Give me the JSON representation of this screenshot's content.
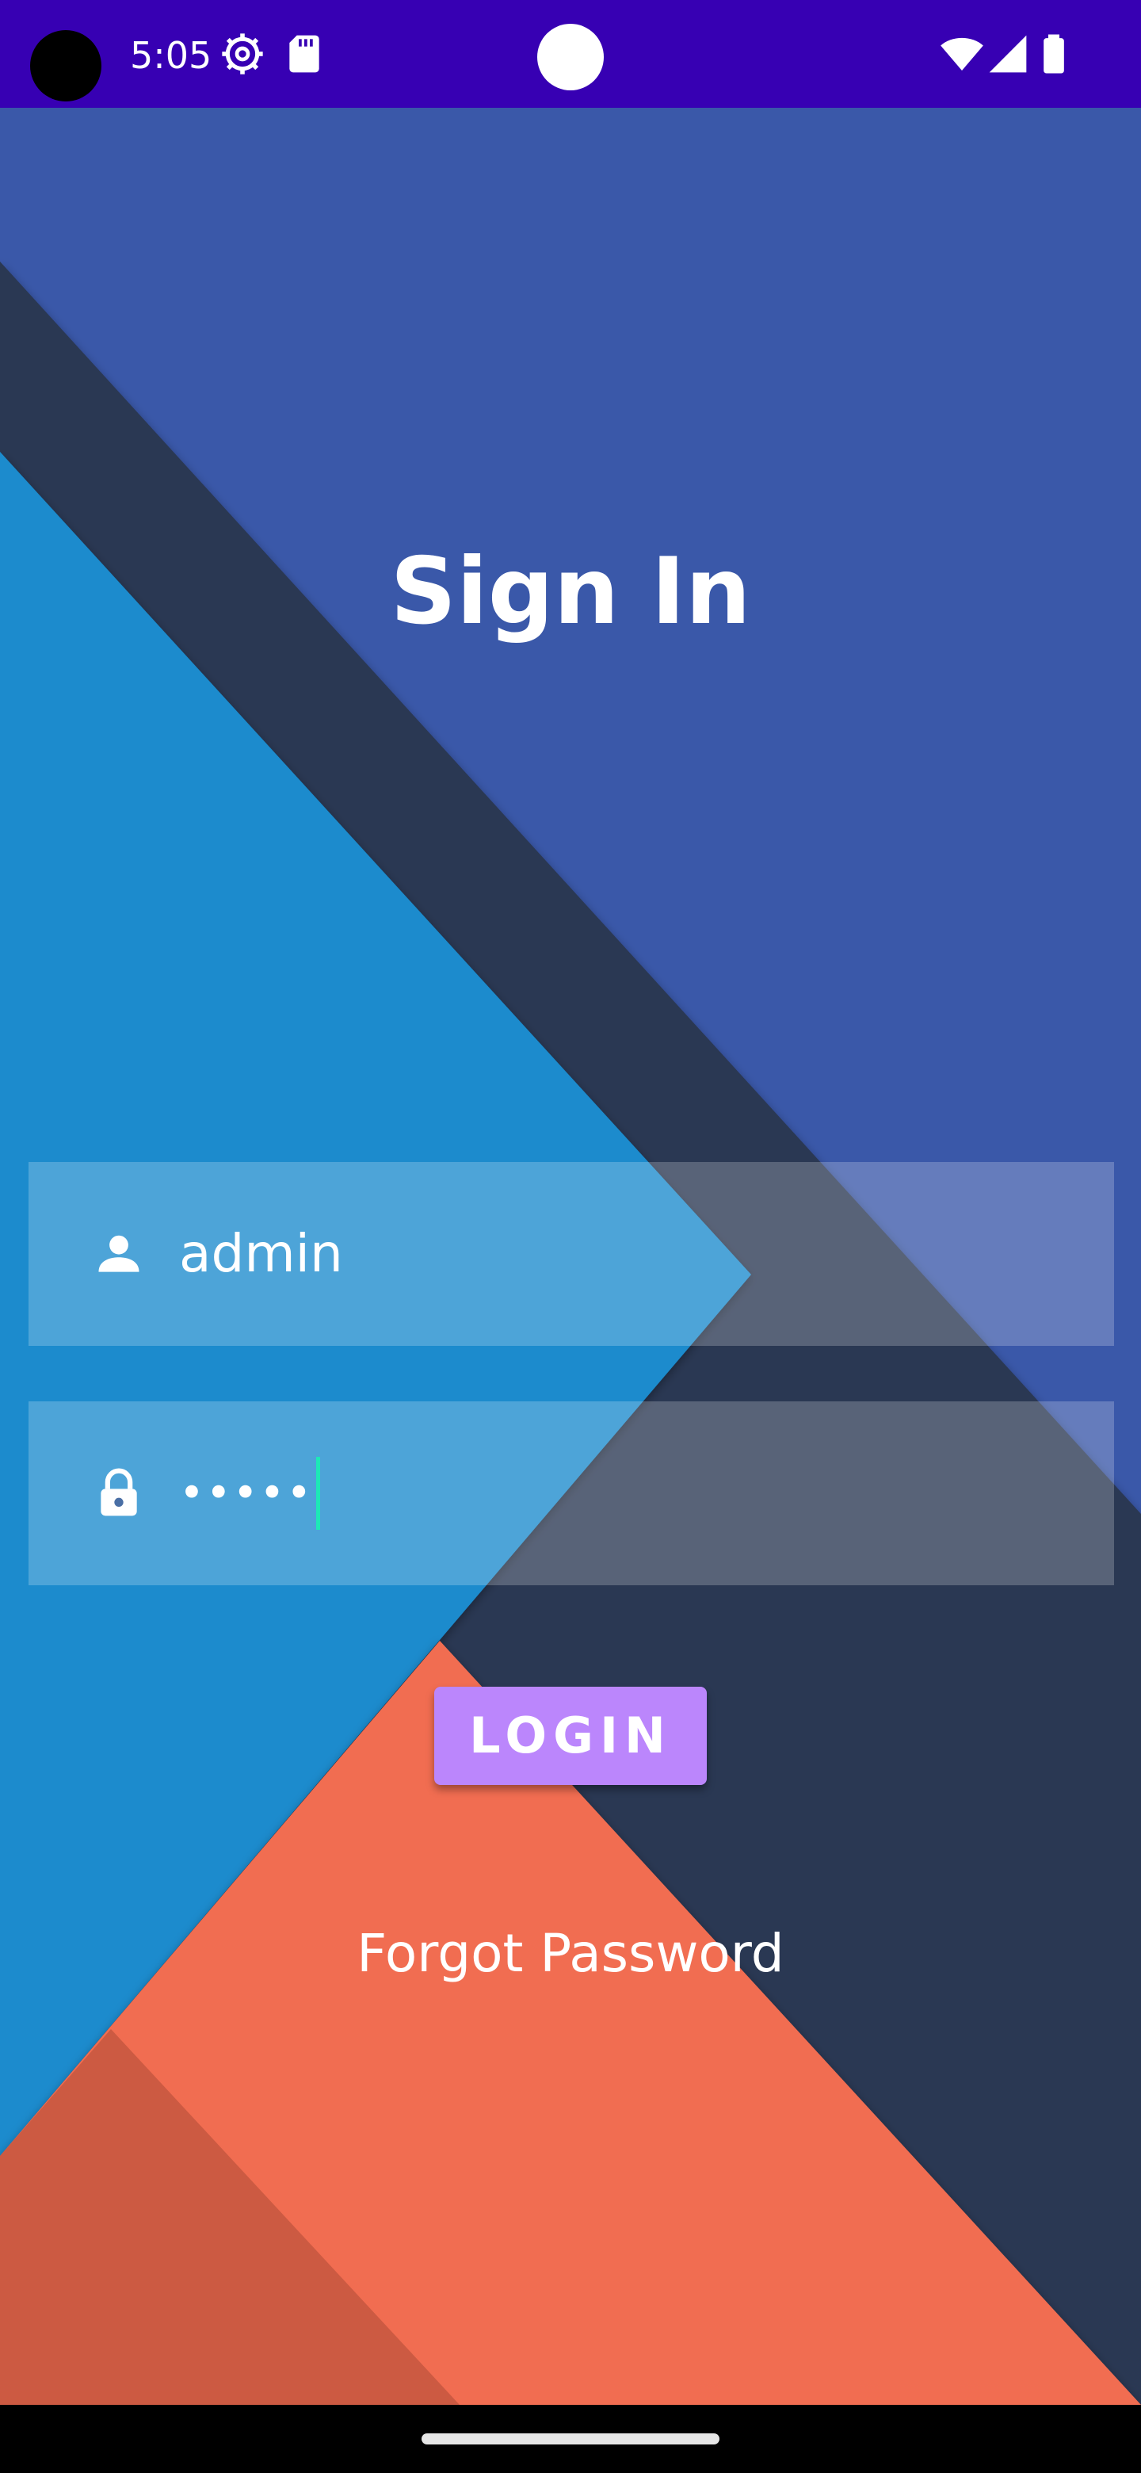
{
  "status_bar": {
    "time": "5:05",
    "icons": [
      "settings-gear-icon",
      "sd-card-icon",
      "wifi-icon",
      "signal-icon",
      "battery-icon"
    ]
  },
  "title": "Sign In",
  "username_field": {
    "icon": "person-icon",
    "value": "admin"
  },
  "password_field": {
    "icon": "lock-icon",
    "value": "•••••"
  },
  "login_button": {
    "label": "LOGIN"
  },
  "forgot_password": {
    "label": "Forgot Password"
  },
  "colors": {
    "status_bar": "#3700b3",
    "background_top": "#3a58a9",
    "dark_band": "#2c3753",
    "blue_triangle": "#1a8bcd",
    "orange_triangle": "#f16d51",
    "button": "#bb86fc",
    "cursor": "#1de9b6"
  }
}
